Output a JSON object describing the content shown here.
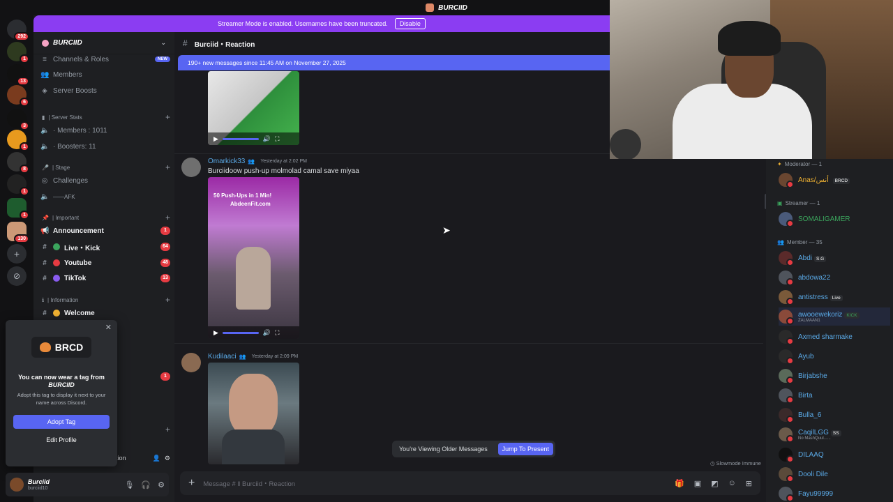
{
  "window": {
    "title": "BURCIID"
  },
  "rail": {
    "servers": [
      {
        "badge": "292"
      },
      {
        "badge": "1"
      },
      {
        "badge": "13"
      },
      {
        "badge": "6"
      },
      {
        "badge": "3"
      },
      {
        "badge": "1"
      },
      {
        "badge": "8"
      },
      {
        "badge": "1"
      },
      {
        "badge": "1"
      },
      {
        "badge": "130"
      }
    ]
  },
  "banner": {
    "text": "Streamer Mode is enabled. Usernames have been truncated.",
    "disable": "Disable"
  },
  "guild": {
    "name": "BURCIID"
  },
  "sidebar": {
    "channels_roles": "Channels & Roles",
    "new_badge": "NEW",
    "members": "Members",
    "boosts": "Server Boosts",
    "cat_stats": "| Server Stats",
    "members_count": "· Members : 1011",
    "boosters": "· Boosters: 11",
    "cat_stage": "| Stage",
    "challenges": "Challenges",
    "afk": "——AFK",
    "cat_important": "| Important",
    "announcement": "Announcement",
    "announcement_badge": "1",
    "live_kick": "Live・Kick",
    "live_kick_badge": "64",
    "youtube": "Youtube",
    "youtube_badge": "48",
    "tiktok": "TikTok",
    "tiktok_badge": "13",
    "cat_info": "| Information",
    "welcome": "Welcome",
    "extra_badge": "1",
    "hidden_channel": "tion"
  },
  "popup": {
    "tag": "BRCD",
    "line1": "You can now wear a tag from",
    "server": "BURCIID",
    "desc": "Adopt this tag to display it next to your name across Discord.",
    "adopt": "Adopt Tag",
    "edit": "Edit Profile"
  },
  "user": {
    "name": "Burciid",
    "handle": "burciid10"
  },
  "chat": {
    "channel": "Burciid・Reaction",
    "new_messages": "190+ new messages since 11:45 AM on November 27, 2025",
    "messages": [
      {
        "author": "Omarkick33",
        "time": "Yesterday at 2:02 PM",
        "text": "Burciidoow push-up molmolad camal save miyaa",
        "video_caption_1": "50 Push-Ups in 1 Min!",
        "video_caption_2": "AbdeenFit.com"
      },
      {
        "author": "Kudilaaci",
        "time": "Yesterday at 2:09 PM",
        "text": ""
      }
    ],
    "older_text": "You're Viewing Older Messages",
    "jump": "Jump To Present",
    "slowmode": "Slowmode Immune",
    "placeholder": "Message # ‖ Burciid・Reaction"
  },
  "members": {
    "moderator_header": "Moderator — 1",
    "streamer_header": "Streamer — 1",
    "member_header": "Member — 35",
    "list": [
      {
        "name": "Anas/أنس",
        "tag": "BRCD",
        "color": "#f0b232"
      },
      {
        "name": "SOMALIGAMER",
        "tag": "",
        "color": "#3ba55d"
      },
      {
        "name": "Abdi",
        "tag": "S.G",
        "color": "#5aa9e6"
      },
      {
        "name": "abdowa22",
        "tag": "",
        "color": "#5aa9e6"
      },
      {
        "name": "antistress",
        "tag": "Live",
        "color": "#5aa9e6"
      },
      {
        "name": "awooewekoriz",
        "tag": "KICK",
        "sub": "ZALMAAN1",
        "color": "#5aa9e6"
      },
      {
        "name": "Axmed sharmake",
        "tag": "",
        "color": "#5aa9e6"
      },
      {
        "name": "Ayub",
        "tag": "",
        "color": "#5aa9e6"
      },
      {
        "name": "Birjabshe",
        "tag": "",
        "color": "#5aa9e6"
      },
      {
        "name": "Birta",
        "tag": "",
        "color": "#5aa9e6"
      },
      {
        "name": "Bulla_6",
        "tag": "",
        "color": "#5aa9e6"
      },
      {
        "name": "CaqilLGG",
        "tag": "SS",
        "sub": "No MashQuul......",
        "color": "#5aa9e6"
      },
      {
        "name": "DILAAQ",
        "tag": "",
        "color": "#5aa9e6"
      },
      {
        "name": "Dooli Dile",
        "tag": "",
        "color": "#5aa9e6"
      },
      {
        "name": "Fayu99999",
        "tag": "",
        "color": "#5aa9e6"
      }
    ]
  }
}
